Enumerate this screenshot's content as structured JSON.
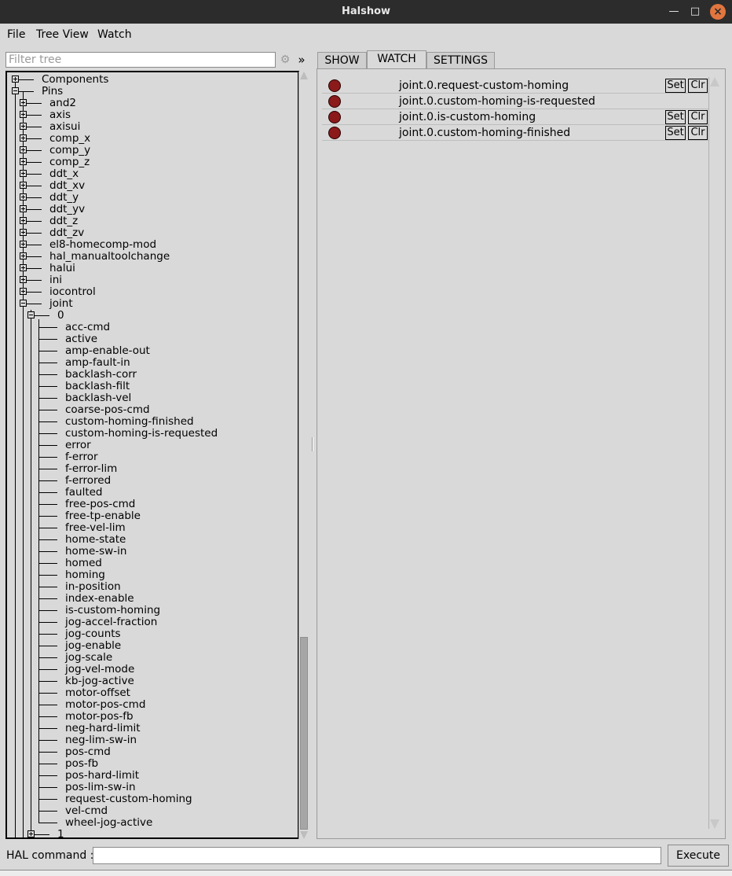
{
  "window": {
    "title": "Halshow",
    "min_glyph": "—",
    "max_glyph": "□",
    "close_glyph": "×"
  },
  "menu": [
    "File",
    "Tree View",
    "Watch"
  ],
  "filter": {
    "placeholder": "Filter tree",
    "value": "",
    "gear_glyph": "⚙",
    "expand_glyph": "»"
  },
  "tabs": [
    {
      "label": "SHOW",
      "active": false
    },
    {
      "label": "WATCH",
      "active": true
    },
    {
      "label": "SETTINGS",
      "active": false
    }
  ],
  "tree": {
    "top": [
      {
        "label": "Components",
        "state": "collapsed"
      },
      {
        "label": "Pins",
        "state": "expanded"
      }
    ],
    "pins": [
      "and2",
      "axis",
      "axisui",
      "comp_x",
      "comp_y",
      "comp_z",
      "ddt_x",
      "ddt_xv",
      "ddt_y",
      "ddt_yv",
      "ddt_z",
      "ddt_zv",
      "el8-homecomp-mod",
      "hal_manualtoolchange",
      "halui",
      "ini",
      "iocontrol",
      "joint"
    ],
    "joint_children": [
      "0",
      "1"
    ],
    "joint0_pins": [
      "acc-cmd",
      "active",
      "amp-enable-out",
      "amp-fault-in",
      "backlash-corr",
      "backlash-filt",
      "backlash-vel",
      "coarse-pos-cmd",
      "custom-homing-finished",
      "custom-homing-is-requested",
      "error",
      "f-error",
      "f-error-lim",
      "f-errored",
      "faulted",
      "free-pos-cmd",
      "free-tp-enable",
      "free-vel-lim",
      "home-state",
      "home-sw-in",
      "homed",
      "homing",
      "in-position",
      "index-enable",
      "is-custom-homing",
      "jog-accel-fraction",
      "jog-counts",
      "jog-enable",
      "jog-scale",
      "jog-vel-mode",
      "kb-jog-active",
      "motor-offset",
      "motor-pos-cmd",
      "motor-pos-fb",
      "neg-hard-limit",
      "neg-lim-sw-in",
      "pos-cmd",
      "pos-fb",
      "pos-hard-limit",
      "pos-lim-sw-in",
      "request-custom-homing",
      "vel-cmd",
      "wheel-jog-active"
    ]
  },
  "watch": {
    "items": [
      {
        "name": "joint.0.request-custom-homing",
        "state": "off",
        "has_buttons": true
      },
      {
        "name": "joint.0.custom-homing-is-requested",
        "state": "off",
        "has_buttons": false
      },
      {
        "name": "joint.0.is-custom-homing",
        "state": "off",
        "has_buttons": true
      },
      {
        "name": "joint.0.custom-homing-finished",
        "state": "off",
        "has_buttons": true
      }
    ],
    "set_label": "Set",
    "clr_label": "Clr",
    "led_off_color": "#8b1a1a"
  },
  "hal": {
    "label": "HAL command :",
    "value": "",
    "execute_label": "Execute"
  }
}
